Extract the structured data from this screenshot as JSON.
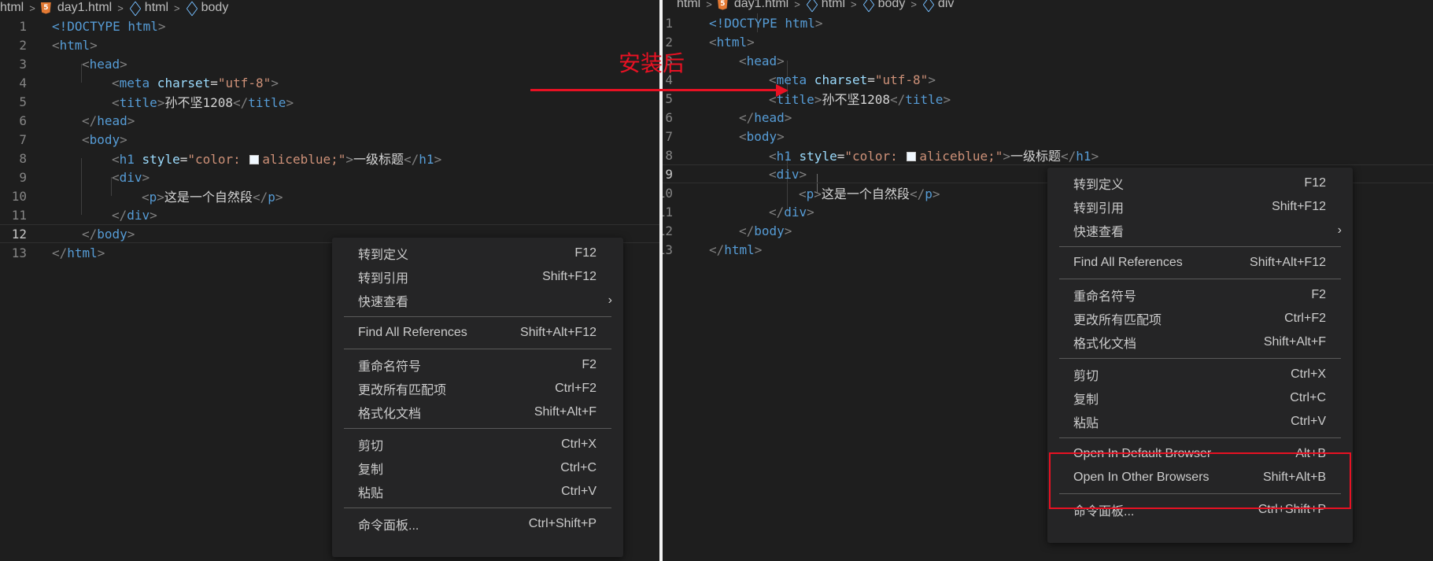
{
  "left": {
    "breadcrumb": [
      "html",
      "day1.html",
      "html",
      "body"
    ],
    "active_line": 12
  },
  "right": {
    "breadcrumb": [
      "html",
      "day1.html",
      "html",
      "body",
      "div"
    ],
    "active_line": 9
  },
  "code": {
    "line_numbers": [
      "1",
      "2",
      "3",
      "4",
      "5",
      "6",
      "7",
      "8",
      "9",
      "10",
      "11",
      "12",
      "13"
    ],
    "doctype": "<!DOCTYPE",
    "doctype_html": " html",
    "html_tag": "html",
    "head_tag": "head",
    "meta_tag": "meta",
    "charset_attr": " charset",
    "charset_value": "\"utf-8\"",
    "title_tag": "title",
    "title_text": "孙不坚1208",
    "body_tag": "body",
    "h1_tag": "h1",
    "style_attr": " style",
    "style_value_open": "\"color: ",
    "style_color": "aliceblue",
    "style_value_close": ";\"",
    "h1_text": "一级标题",
    "div_tag": "div",
    "p_tag": "p",
    "p_text": "这是一个自然段"
  },
  "menu_left": {
    "items": [
      {
        "label": "转到定义",
        "shortcut": "F12"
      },
      {
        "label": "转到引用",
        "shortcut": "Shift+F12"
      },
      {
        "label": "快速查看",
        "shortcut": ""
      },
      {
        "label": "Find All References",
        "shortcut": "Shift+Alt+F12"
      },
      {
        "label": "重命名符号",
        "shortcut": "F2"
      },
      {
        "label": "更改所有匹配项",
        "shortcut": "Ctrl+F2"
      },
      {
        "label": "格式化文档",
        "shortcut": "Shift+Alt+F"
      },
      {
        "label": "剪切",
        "shortcut": "Ctrl+X"
      },
      {
        "label": "复制",
        "shortcut": "Ctrl+C"
      },
      {
        "label": "粘贴",
        "shortcut": "Ctrl+V"
      },
      {
        "label": "命令面板...",
        "shortcut": "Ctrl+Shift+P"
      }
    ]
  },
  "menu_right": {
    "items": [
      {
        "label": "转到定义",
        "shortcut": "F12"
      },
      {
        "label": "转到引用",
        "shortcut": "Shift+F12"
      },
      {
        "label": "快速查看",
        "shortcut": ""
      },
      {
        "label": "Find All References",
        "shortcut": "Shift+Alt+F12"
      },
      {
        "label": "重命名符号",
        "shortcut": "F2"
      },
      {
        "label": "更改所有匹配项",
        "shortcut": "Ctrl+F2"
      },
      {
        "label": "格式化文档",
        "shortcut": "Shift+Alt+F"
      },
      {
        "label": "剪切",
        "shortcut": "Ctrl+X"
      },
      {
        "label": "复制",
        "shortcut": "Ctrl+C"
      },
      {
        "label": "粘贴",
        "shortcut": "Ctrl+V"
      },
      {
        "label": "Open In Default Browser",
        "shortcut": "Alt+B"
      },
      {
        "label": "Open In Other Browsers",
        "shortcut": "Shift+Alt+B"
      },
      {
        "label": "命令面板...",
        "shortcut": "Ctrl+Shift+P"
      }
    ]
  },
  "annotation": {
    "text": "安装后",
    "color": "#e81123"
  },
  "icons": {
    "file": "html5-icon",
    "symbol": "cube-icon",
    "submenu": "chevron-right-icon"
  }
}
